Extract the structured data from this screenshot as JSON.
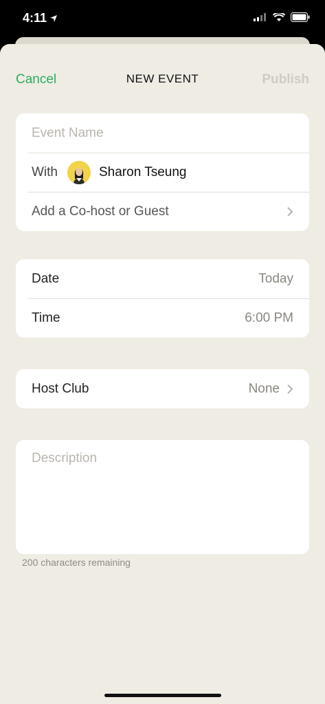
{
  "status": {
    "time": "4:11"
  },
  "nav": {
    "cancel": "Cancel",
    "title": "NEW EVENT",
    "publish": "Publish"
  },
  "event": {
    "name_placeholder": "Event Name",
    "with_label": "With",
    "host_name": "Sharon Tseung",
    "cohost_label": "Add a Co-host or Guest"
  },
  "schedule": {
    "date_label": "Date",
    "date_value": "Today",
    "time_label": "Time",
    "time_value": "6:00 PM"
  },
  "club": {
    "label": "Host Club",
    "value": "None"
  },
  "description": {
    "placeholder": "Description",
    "remaining": "200 characters remaining"
  },
  "colors": {
    "accent": "#27ae60",
    "background": "#efece4",
    "card": "#ffffff"
  }
}
